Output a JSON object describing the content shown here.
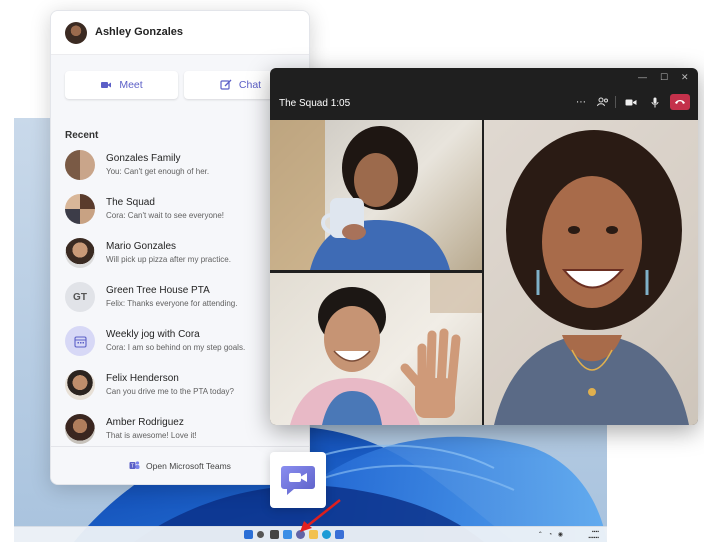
{
  "user": {
    "name": "Ashley Gonzales"
  },
  "actions": {
    "meet_label": "Meet",
    "chat_label": "Chat"
  },
  "recent": {
    "heading": "Recent",
    "items": [
      {
        "name": "Gonzales Family",
        "preview": "You: Can't get enough of her."
      },
      {
        "name": "The Squad",
        "preview": "Cora: Can't wait to see everyone!"
      },
      {
        "name": "Mario Gonzales",
        "preview": "Will pick up pizza after my practice."
      },
      {
        "name": "Green Tree House PTA",
        "preview": "Felix: Thanks everyone for attending.",
        "initials": "GT"
      },
      {
        "name": "Weekly jog with Cora",
        "preview": "Cora: I am so behind on my step goals."
      },
      {
        "name": "Felix Henderson",
        "preview": "Can you drive me to the PTA today?"
      },
      {
        "name": "Amber Rodriguez",
        "preview": "That is awesome! Love it!"
      }
    ]
  },
  "footer": {
    "label": "Open Microsoft Teams"
  },
  "call": {
    "title": "The Squad 1:05"
  },
  "colors": {
    "teams_purple": "#5b5fc7",
    "hangup_red": "#c4314b",
    "call_bg": "#1f1f1f"
  },
  "icons": [
    "video-icon",
    "chat-edit-icon",
    "teams-icon",
    "more-icon",
    "participants-icon",
    "camera-icon",
    "mic-icon",
    "hangup-icon",
    "minimize-icon",
    "maximize-icon",
    "close-icon",
    "calendar-icon"
  ]
}
